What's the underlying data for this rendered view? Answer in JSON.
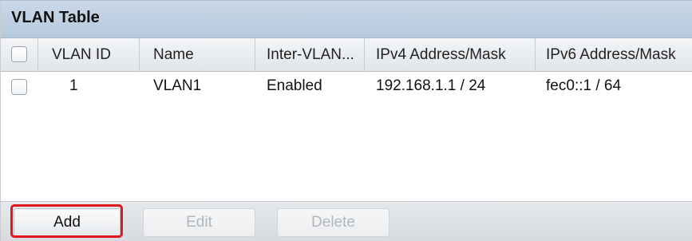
{
  "table": {
    "title": "VLAN Table",
    "columns": [
      "VLAN ID",
      "Name",
      "Inter-VLAN...",
      "IPv4 Address/Mask",
      "IPv6 Address/Mask"
    ],
    "rows": [
      {
        "vlan_id": "1",
        "name": "VLAN1",
        "inter_vlan": "Enabled",
        "ipv4": "192.168.1.1 / 24",
        "ipv6": "fec0::1 / 64"
      }
    ]
  },
  "buttons": {
    "add": "Add",
    "edit": "Edit",
    "delete": "Delete"
  },
  "colors": {
    "highlight": "#e0191f",
    "title_bar": "#c9d8e8"
  }
}
